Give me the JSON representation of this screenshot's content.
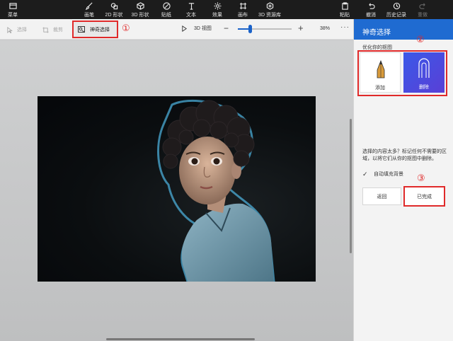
{
  "toolbar": {
    "menu": "菜单",
    "brush": "画笔",
    "shapes2d": "2D 形状",
    "shapes3d": "3D 形状",
    "stickers": "贴纸",
    "text": "文本",
    "effects": "效果",
    "canvas": "画布",
    "library3d": "3D 资源库",
    "paste": "粘贴",
    "undo": "撤消",
    "history": "历史记录",
    "redo": "重做"
  },
  "subtoolbar": {
    "select": "选择",
    "crop": "裁剪",
    "magic_select": "神奇选择",
    "view_3d": "3D 视图",
    "zoom_minus": "−",
    "zoom_plus": "+",
    "zoom_level": "38%",
    "zoom_fraction": 0.22,
    "more": "···"
  },
  "annotations": {
    "one": "①",
    "two": "②",
    "three": "③"
  },
  "panel": {
    "title": "神奇选择",
    "refine_label": "优化你的抠图",
    "add": "添加",
    "remove": "删除",
    "help": "选择的内容太多？标记任何不需要的区域，以将它们从你的抠图中删除。",
    "autofill_check": "✓",
    "autofill": "自动填充背景",
    "back": "返回",
    "done": "已完成"
  },
  "colors": {
    "accent": "#1f6bd1",
    "annotation_red": "#e02a2a",
    "topbar": "#1c1c1c"
  }
}
